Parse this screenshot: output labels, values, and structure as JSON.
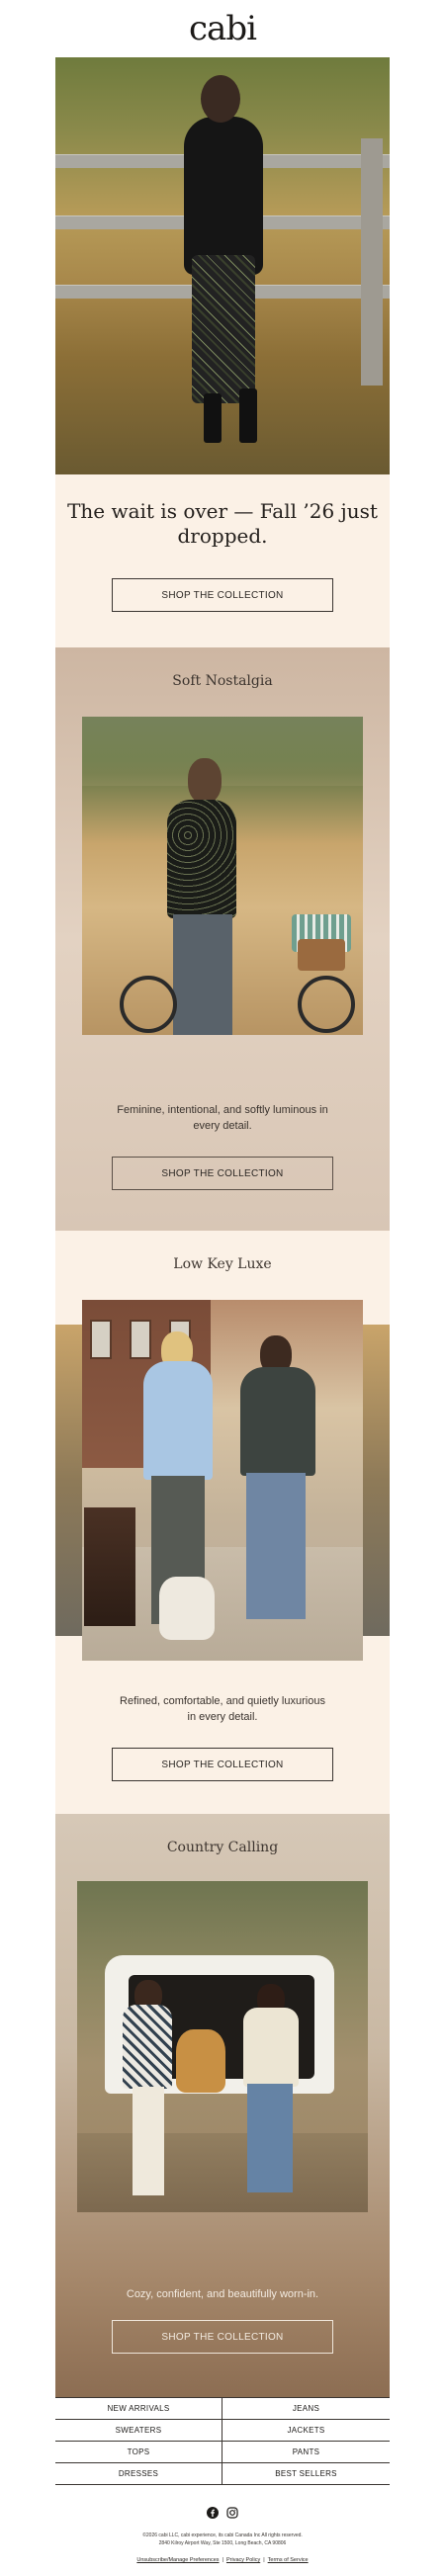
{
  "header": {
    "logo_text": "cabi"
  },
  "hero": {
    "title": "The wait is over — Fall ’26 just dropped.",
    "button_label": "SHOP THE COLLECTION"
  },
  "sections": [
    {
      "title": "Soft Nostalgia",
      "body": "Feminine, intentional, and softly luminous in every detail.",
      "button_label": "SHOP THE COLLECTION"
    },
    {
      "title": "Low Key Luxe",
      "body": "Refined, comfortable, and quietly luxurious in every detail.",
      "button_label": "SHOP THE COLLECTION"
    },
    {
      "title": "Country Calling",
      "body": "Cozy, confident, and beautifully worn-in.",
      "button_label": "SHOP THE COLLECTION"
    }
  ],
  "categories": [
    [
      "NEW ARRIVALS",
      "JEANS"
    ],
    [
      "SWEATERS",
      "JACKETS"
    ],
    [
      "TOPS",
      "PANTS"
    ],
    [
      "DRESSES",
      "BEST SELLERS"
    ]
  ],
  "social": {
    "icons": [
      "facebook-icon",
      "instagram-icon"
    ]
  },
  "footer": {
    "legal_line1": "©2026 cabi LLC, cabi experience, its cabi Canada Inc All rights reserved.",
    "legal_line2": "2840 Kilroy Airport Way, Ste 1500, Long Beach, CA 90806",
    "link_unsubscribe": "Unsubscribe/Manage Preferences",
    "link_privacy": "Privacy Policy",
    "link_terms": "Terms of Service",
    "separator": "|"
  },
  "colors": {
    "cream": "#fbf1e6",
    "mauve": "#cdb6a2",
    "text_dark": "#2a2623",
    "border": "#3a3531"
  }
}
